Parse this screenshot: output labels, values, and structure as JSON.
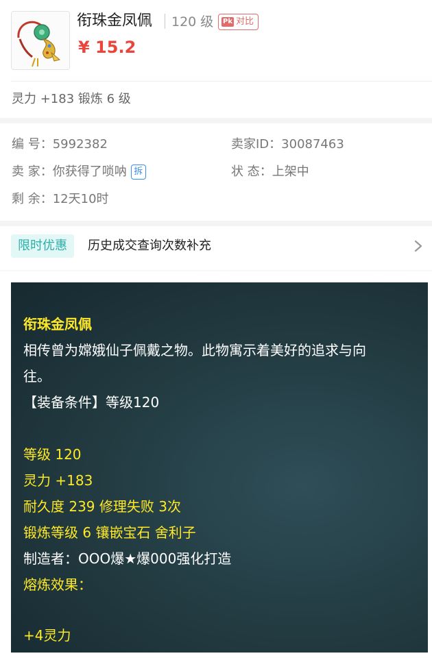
{
  "item": {
    "title": "衔珠金凤佩",
    "level": "120 级",
    "compare_badge": "Pk",
    "compare_label": "对比",
    "price": "¥ 15.2"
  },
  "stat_summary": "灵力 +183 锻炼 6 级",
  "info": {
    "serial_label": "编 号：",
    "serial_value": "5992382",
    "seller_id_label": "卖家ID：",
    "seller_id_value": "30087463",
    "seller_label": "卖 家：",
    "seller_value": "你获得了唢呐",
    "seller_badge": "拆",
    "status_label": "状 态：",
    "status_value": "上架中",
    "remaining_label": "剩 余：",
    "remaining_value": "12天10时"
  },
  "promo": {
    "tag": "限时优惠",
    "text": "历史成交查询次数补充"
  },
  "description": {
    "name": "衔珠金凤佩",
    "lore_line1": "相传曾为嫦娥仙子佩戴之物。此物寓示着美好的追求与向",
    "lore_line2": "往。",
    "requirement": "【装备条件】等级120",
    "level": "等级 120",
    "spirit": "灵力 +183",
    "durability": "耐久度 239 修理失败 3次",
    "forge": "锻炼等级 6 镶嵌宝石 舍利子",
    "maker": "制造者：OOO爆★爆000强化打造",
    "smelt_label": "熔炼效果：",
    "smelt_value": "+4灵力"
  },
  "icons": {
    "item": "jade-pendant-icon",
    "chevron": "chevron-right-icon"
  },
  "colors": {
    "price": "#e8453c",
    "promo_bg": "#e2f7f6",
    "promo_text": "#2bb0a8",
    "panel_bg": "#21393f",
    "highlight_yellow": "#ffe926",
    "badge_blue": "#3b8cf0"
  }
}
